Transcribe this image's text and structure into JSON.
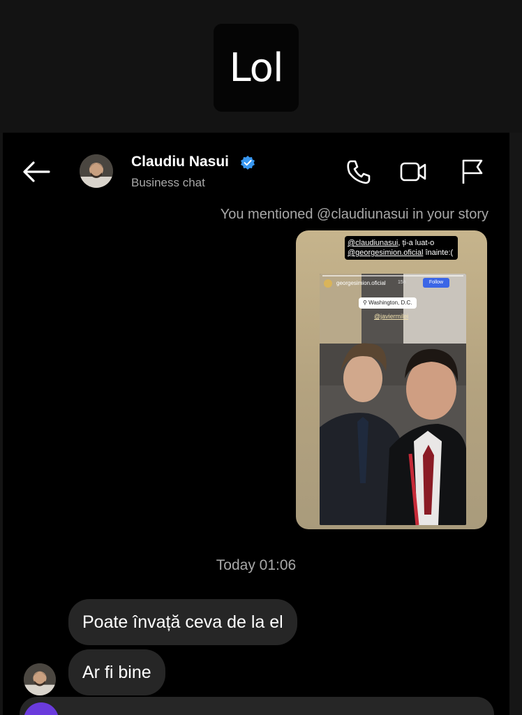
{
  "caption": {
    "text": "Lol"
  },
  "header": {
    "contact_name": "Claudiu Nasui",
    "subtitle": "Business chat",
    "icons": [
      "back-arrow-icon",
      "verified-badge-icon",
      "phone-icon",
      "video-camera-icon",
      "flag-icon"
    ]
  },
  "colors": {
    "verified": "#3897f0",
    "bubble": "#262626",
    "background": "#000000",
    "muted_text": "#a8a8a8",
    "follow_button": "#3b66e6"
  },
  "thread": {
    "mention_note": "You mentioned @claudiunasui in your story",
    "story": {
      "mention_line1_handle": "@claudiunasui",
      "mention_line1_rest": ", ți-a luat-o",
      "mention_line2_handle": "@georgesimion.oficial",
      "mention_line2_rest": " înainte:(",
      "inner_username": "georgesimion.oficial",
      "inner_time": "15h",
      "follow_label": "Follow",
      "location": "Washington, D.C.",
      "tagged_handle": "@javiermilei"
    },
    "date_separator": "Today 01:06",
    "messages": [
      {
        "text": "Poate învață ceva de la el"
      },
      {
        "text": "Ar fi bine"
      }
    ]
  }
}
